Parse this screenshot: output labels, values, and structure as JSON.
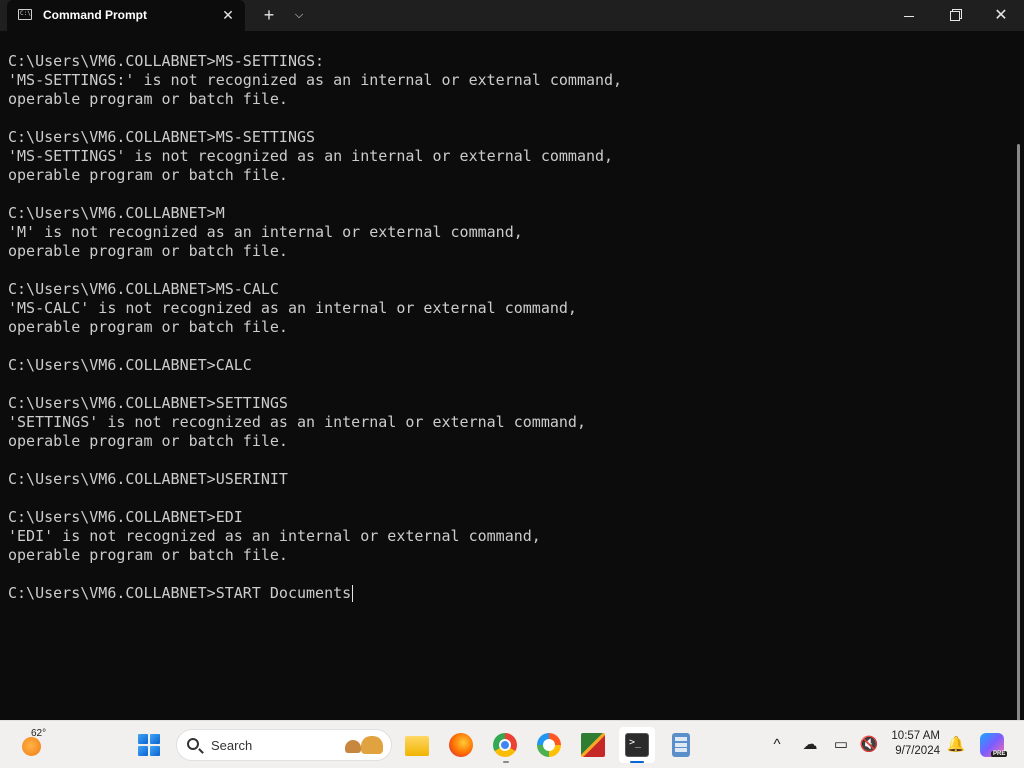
{
  "window": {
    "tab_title": "Command Prompt",
    "tab_icon_text": "C:\\",
    "close_tab": "✕",
    "new_tab": "+",
    "dropdown": "⌵",
    "close": "✕"
  },
  "console": {
    "lines": [
      "",
      "C:\\Users\\VM6.COLLABNET>MS-SETTINGS:",
      "'MS-SETTINGS:' is not recognized as an internal or external command,",
      "operable program or batch file.",
      "",
      "C:\\Users\\VM6.COLLABNET>MS-SETTINGS",
      "'MS-SETTINGS' is not recognized as an internal or external command,",
      "operable program or batch file.",
      "",
      "C:\\Users\\VM6.COLLABNET>M",
      "'M' is not recognized as an internal or external command,",
      "operable program or batch file.",
      "",
      "C:\\Users\\VM6.COLLABNET>MS-CALC",
      "'MS-CALC' is not recognized as an internal or external command,",
      "operable program or batch file.",
      "",
      "C:\\Users\\VM6.COLLABNET>CALC",
      "",
      "C:\\Users\\VM6.COLLABNET>SETTINGS",
      "'SETTINGS' is not recognized as an internal or external command,",
      "operable program or batch file.",
      "",
      "C:\\Users\\VM6.COLLABNET>USERINIT",
      "",
      "C:\\Users\\VM6.COLLABNET>EDI",
      "'EDI' is not recognized as an internal or external command,",
      "operable program or batch file.",
      "",
      "C:\\Users\\VM6.COLLABNET>START Documents"
    ]
  },
  "taskbar": {
    "weather_temp": "62°",
    "search_placeholder": "Search",
    "clock_time": "10:57 AM",
    "clock_date": "9/7/2024",
    "copilot_badge": "PRE",
    "chevron": "^",
    "bell": "🔔",
    "accent_color": "#0a64d6"
  }
}
